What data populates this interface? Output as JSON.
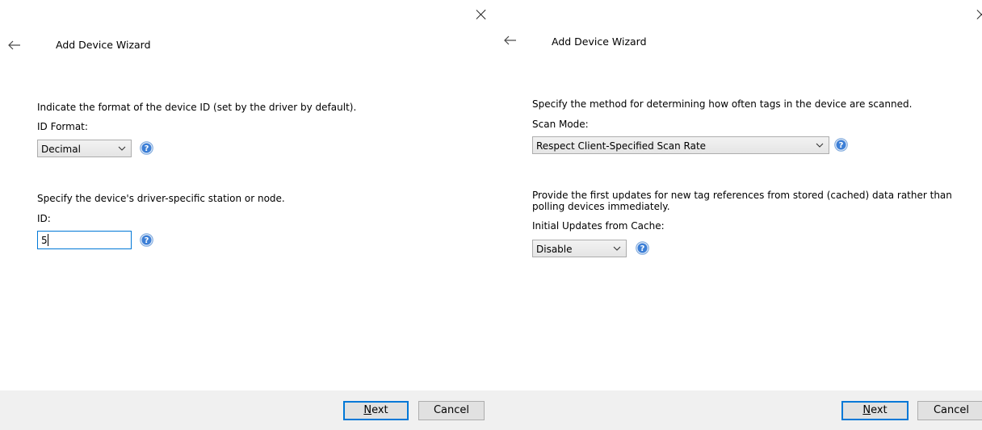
{
  "left": {
    "title": "Add Device Wizard",
    "id_format_desc": "Indicate the format of the device ID (set by the driver by default).",
    "id_format_label": "ID Format:",
    "id_format_value": "Decimal",
    "station_desc": "Specify the device's driver-specific station or node.",
    "id_label": "ID:",
    "id_value": "5",
    "next_label_u": "N",
    "next_label_rest": "ext",
    "cancel_label": "Cancel"
  },
  "right": {
    "title": "Add Device Wizard",
    "scan_desc": "Specify the method for determining how often tags in the device are scanned.",
    "scan_mode_label": "Scan Mode:",
    "scan_mode_value": "Respect Client-Specified Scan Rate",
    "cache_desc_line1": "Provide the first updates for new tag references from stored (cached) data rather than",
    "cache_desc_line2": "polling devices immediately.",
    "cache_label": "Initial Updates from Cache:",
    "cache_value": "Disable",
    "next_label_u": "N",
    "next_label_rest": "ext",
    "cancel_label": "Cancel"
  },
  "icons": {
    "close": "close-icon",
    "back": "back-arrow-icon",
    "dropdown": "chevron-down-icon",
    "help": "help-icon"
  },
  "colors": {
    "accent": "#0078d7",
    "footer_bg": "#f0f0f0",
    "help_blue": "#3d7fd6"
  }
}
